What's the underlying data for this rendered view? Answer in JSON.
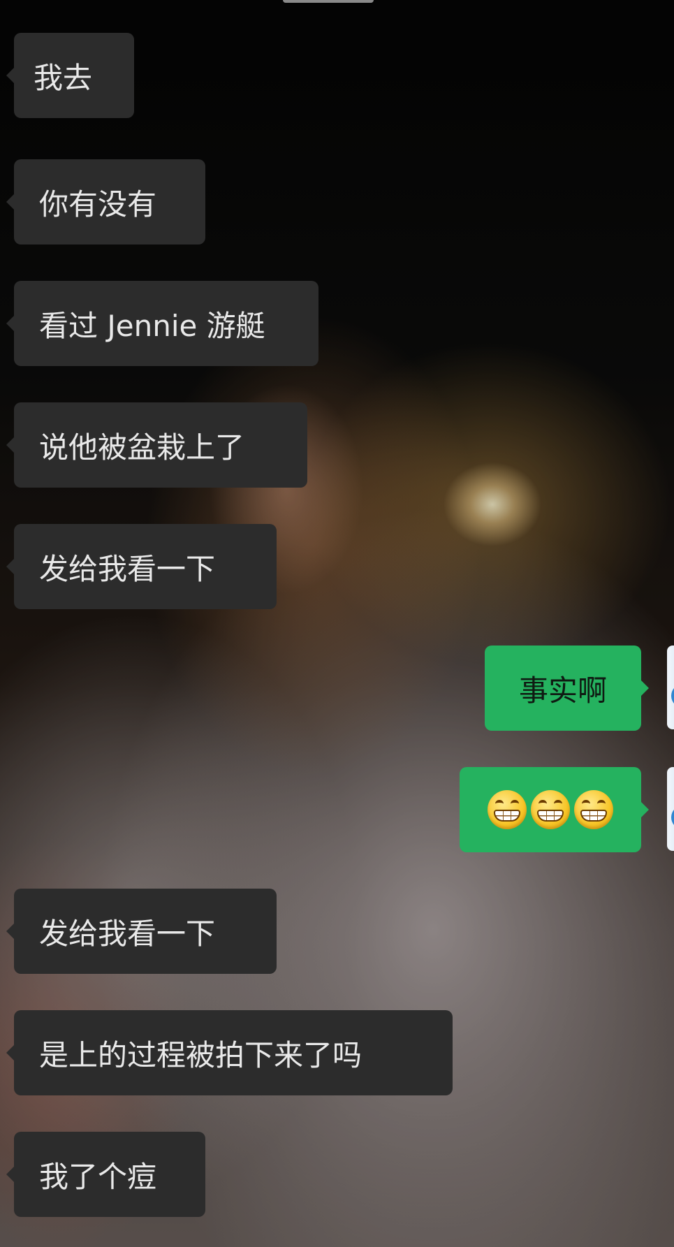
{
  "chat": {
    "messages": [
      {
        "sender": "other",
        "text": "我去"
      },
      {
        "sender": "other",
        "text": "你有没有"
      },
      {
        "sender": "other",
        "text": "看过 Jennie 游艇"
      },
      {
        "sender": "other",
        "text": "说他被盆栽上了"
      },
      {
        "sender": "other",
        "text": "发给我看一下"
      },
      {
        "sender": "me",
        "text": "事实啊"
      },
      {
        "sender": "me",
        "emoji": [
          "grinning-face-with-teeth",
          "grinning-face-with-teeth",
          "grinning-face-with-teeth"
        ]
      },
      {
        "sender": "other",
        "text": "发给我看一下"
      },
      {
        "sender": "other",
        "text": "是上的过程被拍下来了吗"
      },
      {
        "sender": "other",
        "text": "我了个痘"
      }
    ]
  },
  "colors": {
    "incoming_bubble": "#2c2c2c",
    "incoming_text": "#e9e9e9",
    "outgoing_bubble": "#25b25f",
    "outgoing_text": "#0f1a12"
  },
  "icons": {
    "avatar": "user-avatar",
    "emoji": "grinning-face-with-teeth"
  }
}
